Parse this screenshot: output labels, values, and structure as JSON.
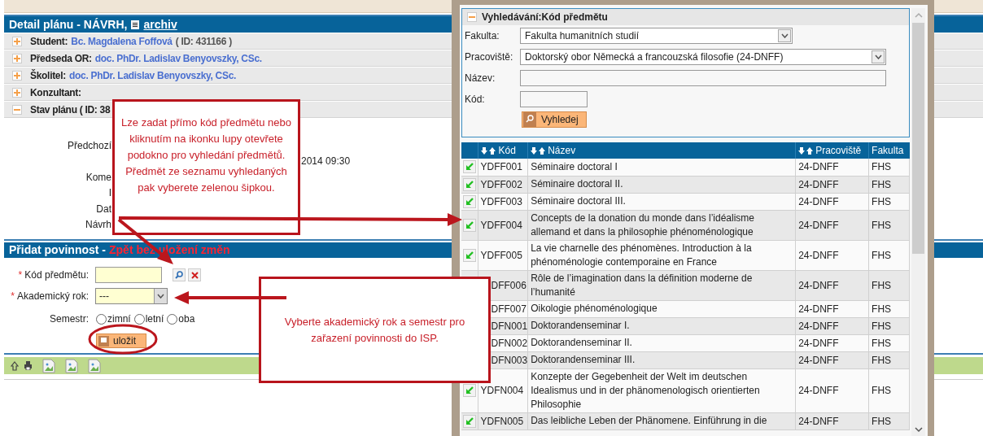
{
  "detail": {
    "title": "Detail plánu - NÁVRH,",
    "archive_link": "archiv",
    "sections": [
      {
        "label": "Student:",
        "value": "Bc. Magdalena Foffová",
        "extra": "( ID: 431166 )",
        "expanded": false
      },
      {
        "label": "Předseda OR:",
        "value": "doc. PhDr. Ladislav Benyovszky, CSc.",
        "expanded": false
      },
      {
        "label": "Školitel:",
        "value": "doc. PhDr. Ladislav Benyovszky, CSc.",
        "expanded": false
      },
      {
        "label": "Konzultant:",
        "expanded": false
      },
      {
        "label": "Stav plánu ( ID: 38",
        "expanded": true
      }
    ],
    "state_rows": [
      {
        "label": "Předchozí"
      },
      {
        "value": "2014 09:30"
      },
      {
        "label": "Kome"
      },
      {
        "label": "I"
      },
      {
        "label": "Dat"
      },
      {
        "label": "Návrh"
      }
    ]
  },
  "add_duty": {
    "title": "Přidat povinnost -",
    "back_link": "Zpět bez uložení změn",
    "fields": [
      {
        "kind": "code",
        "marker": "*",
        "label": "Kód předmětu:"
      },
      {
        "kind": "select",
        "marker": "*",
        "label": "Akademický rok:",
        "value": "---"
      },
      {
        "kind": "radios",
        "label": "Semestr:",
        "options": [
          {
            "label": "zimní",
            "selected": false
          },
          {
            "label": "letní",
            "selected": false
          },
          {
            "label": "oba",
            "selected": false
          }
        ]
      }
    ],
    "save_button": "uložit"
  },
  "search_popup": {
    "title": "Vyhledávání:Kód předmětu",
    "expanded": true,
    "fields": [
      {
        "kind": "select",
        "label": "Fakulta:",
        "value": "Fakulta humanitních studií"
      },
      {
        "kind": "select-wide",
        "label": "Pracoviště:",
        "value": "Doktorský obor Německá a francouzská filosofie (24-DNFF)"
      },
      {
        "kind": "text",
        "label": "Název:"
      },
      {
        "kind": "text-short",
        "label": "Kód:"
      }
    ],
    "search_button": "Vyhledej"
  },
  "results": {
    "columns": [
      {
        "label": "Kód",
        "sortable": true
      },
      {
        "label": "Název",
        "sortable": true
      },
      {
        "label": "Pracoviště",
        "sortable": true
      },
      {
        "label": "Fakulta",
        "sortable": false
      }
    ],
    "rows": [
      {
        "pick_button": true,
        "code": "YDFF001",
        "name": "Séminaire doctoral I",
        "department": "24-DNFF",
        "faculty": "FHS"
      },
      {
        "pick_button": true,
        "code": "YDFF002",
        "name": "Séminaire doctoral II.",
        "department": "24-DNFF",
        "faculty": "FHS"
      },
      {
        "pick_button": true,
        "code": "YDFF003",
        "name": "Séminaire doctoral III.",
        "department": "24-DNFF",
        "faculty": "FHS"
      },
      {
        "pick_button": true,
        "code": "YDFF004",
        "name": "Concepts de la donation du monde dans l’idéalisme allemand et dans la philosophie phénoménologique",
        "department": "24-DNFF",
        "faculty": "FHS"
      },
      {
        "pick_button": true,
        "code": "YDFF005",
        "name": "La vie charnelle des phénomènes. Introduction à la phénoménologie contemporaine en France",
        "department": "24-DNFF",
        "faculty": "FHS"
      },
      {
        "pick_button": false,
        "code": "DFF006",
        "name": "Rôle de l’imagination dans la définition moderne de l’humanité",
        "department": "24-DNFF",
        "faculty": "FHS"
      },
      {
        "pick_button": false,
        "code": "DFF007",
        "name": "Oikologie phénoménologique",
        "department": "24-DNFF",
        "faculty": "FHS"
      },
      {
        "pick_button": false,
        "code": "DFN001",
        "name": "Doktorandenseminar I.",
        "department": "24-DNFF",
        "faculty": "FHS"
      },
      {
        "pick_button": false,
        "code": "DFN002",
        "name": "Doktorandenseminar II.",
        "department": "24-DNFF",
        "faculty": "FHS"
      },
      {
        "pick_button": false,
        "code": "DFN003",
        "name": "Doktorandenseminar III.",
        "department": "24-DNFF",
        "faculty": "FHS"
      },
      {
        "pick_button": true,
        "code": "YDFN004",
        "name": "Konzepte der Gegebenheit der Welt im deutschen Idealismus und in der phänomenologisch orientierten Philosophie",
        "department": "24-DNFF",
        "faculty": "FHS"
      },
      {
        "pick_button": true,
        "code": "YDFN005",
        "name": "Das leibliche Leben der Phänomene. Einführung in die",
        "department": "24-DNFF",
        "faculty": "FHS"
      }
    ]
  },
  "callouts": [
    {
      "text": "Lze zadat přímo kód předmětu nebo kliknutím na ikonku lupy otevřete podokno pro vyhledání předmětů. Předmět ze seznamu vyhledaných pak vyberete zelenou šipkou."
    },
    {
      "text": "Vyberte akademický rok a semestr pro zařazení povinnosti do ISP."
    }
  ]
}
